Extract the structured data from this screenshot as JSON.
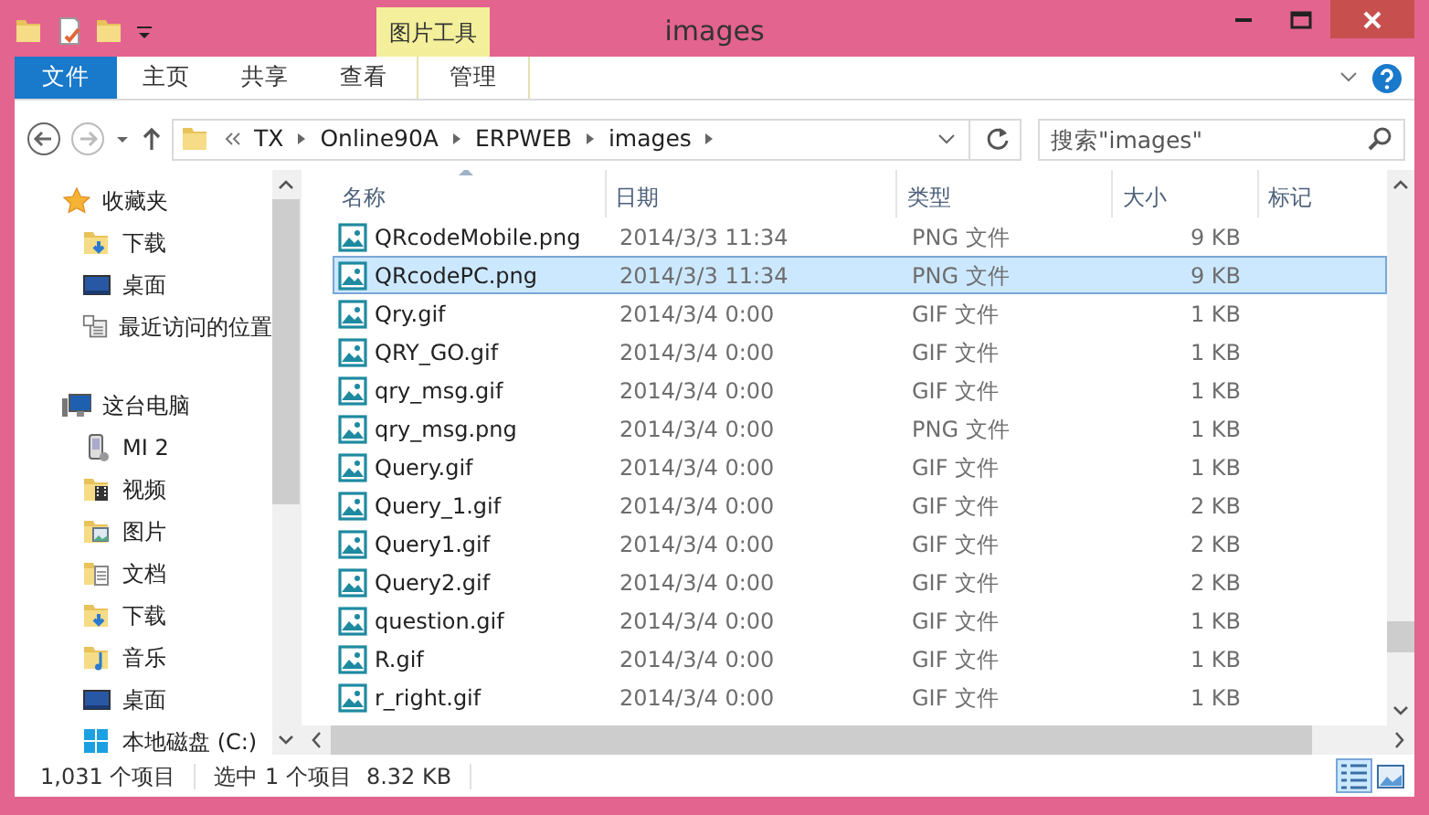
{
  "window": {
    "title": "images"
  },
  "ribbon": {
    "context_group": "图片工具",
    "tabs": [
      {
        "label": "文件",
        "kind": "file",
        "selected": false
      },
      {
        "label": "主页",
        "kind": "tab",
        "selected": false
      },
      {
        "label": "共享",
        "kind": "tab",
        "selected": false
      },
      {
        "label": "查看",
        "kind": "tab",
        "selected": false
      },
      {
        "label": "管理",
        "kind": "context",
        "selected": false
      }
    ]
  },
  "address_bar": {
    "breadcrumbs": [
      "TX",
      "Online90A",
      "ERPWEB",
      "images"
    ]
  },
  "search": {
    "placeholder": "搜索\"images\""
  },
  "navigation": [
    {
      "label": "收藏夹",
      "kind": "favorites",
      "children": [
        {
          "label": "下载",
          "kind": "download"
        },
        {
          "label": "桌面",
          "kind": "desktop"
        },
        {
          "label": "最近访问的位置",
          "kind": "recent"
        }
      ]
    },
    {
      "label": "这台电脑",
      "kind": "computer",
      "children": [
        {
          "label": "MI 2",
          "kind": "phone"
        },
        {
          "label": "视频",
          "kind": "video"
        },
        {
          "label": "图片",
          "kind": "pictures"
        },
        {
          "label": "文档",
          "kind": "documents"
        },
        {
          "label": "下载",
          "kind": "download"
        },
        {
          "label": "音乐",
          "kind": "music"
        },
        {
          "label": "桌面",
          "kind": "desktop"
        },
        {
          "label": "本地磁盘 (C:)",
          "kind": "drive"
        }
      ]
    }
  ],
  "columns": [
    {
      "label": "名称",
      "sorted": true
    },
    {
      "label": "日期",
      "sorted": false
    },
    {
      "label": "类型",
      "sorted": false
    },
    {
      "label": "大小",
      "sorted": false
    },
    {
      "label": "标记",
      "sorted": false
    }
  ],
  "rows": [
    {
      "name": "QRcodeMobile.png",
      "date": "2014/3/3 11:34",
      "type": "PNG 文件",
      "size": "9 KB",
      "selected": false
    },
    {
      "name": "QRcodePC.png",
      "date": "2014/3/3 11:34",
      "type": "PNG 文件",
      "size": "9 KB",
      "selected": true
    },
    {
      "name": "Qry.gif",
      "date": "2014/3/4 0:00",
      "type": "GIF 文件",
      "size": "1 KB",
      "selected": false
    },
    {
      "name": "QRY_GO.gif",
      "date": "2014/3/4 0:00",
      "type": "GIF 文件",
      "size": "1 KB",
      "selected": false
    },
    {
      "name": "qry_msg.gif",
      "date": "2014/3/4 0:00",
      "type": "GIF 文件",
      "size": "1 KB",
      "selected": false
    },
    {
      "name": "qry_msg.png",
      "date": "2014/3/4 0:00",
      "type": "PNG 文件",
      "size": "1 KB",
      "selected": false
    },
    {
      "name": "Query.gif",
      "date": "2014/3/4 0:00",
      "type": "GIF 文件",
      "size": "1 KB",
      "selected": false
    },
    {
      "name": "Query_1.gif",
      "date": "2014/3/4 0:00",
      "type": "GIF 文件",
      "size": "2 KB",
      "selected": false
    },
    {
      "name": "Query1.gif",
      "date": "2014/3/4 0:00",
      "type": "GIF 文件",
      "size": "2 KB",
      "selected": false
    },
    {
      "name": "Query2.gif",
      "date": "2014/3/4 0:00",
      "type": "GIF 文件",
      "size": "2 KB",
      "selected": false
    },
    {
      "name": "question.gif",
      "date": "2014/3/4 0:00",
      "type": "GIF 文件",
      "size": "1 KB",
      "selected": false
    },
    {
      "name": "R.gif",
      "date": "2014/3/4 0:00",
      "type": "GIF 文件",
      "size": "1 KB",
      "selected": false
    },
    {
      "name": "r_right.gif",
      "date": "2014/3/4 0:00",
      "type": "GIF 文件",
      "size": "1 KB",
      "selected": false
    }
  ],
  "status_bar": {
    "item_count": "1,031 个项目",
    "selection": "选中 1 个项目",
    "selection_size": "8.32 KB"
  },
  "views": [
    {
      "kind": "details",
      "selected": true
    },
    {
      "kind": "thumbnails",
      "selected": false
    }
  ]
}
